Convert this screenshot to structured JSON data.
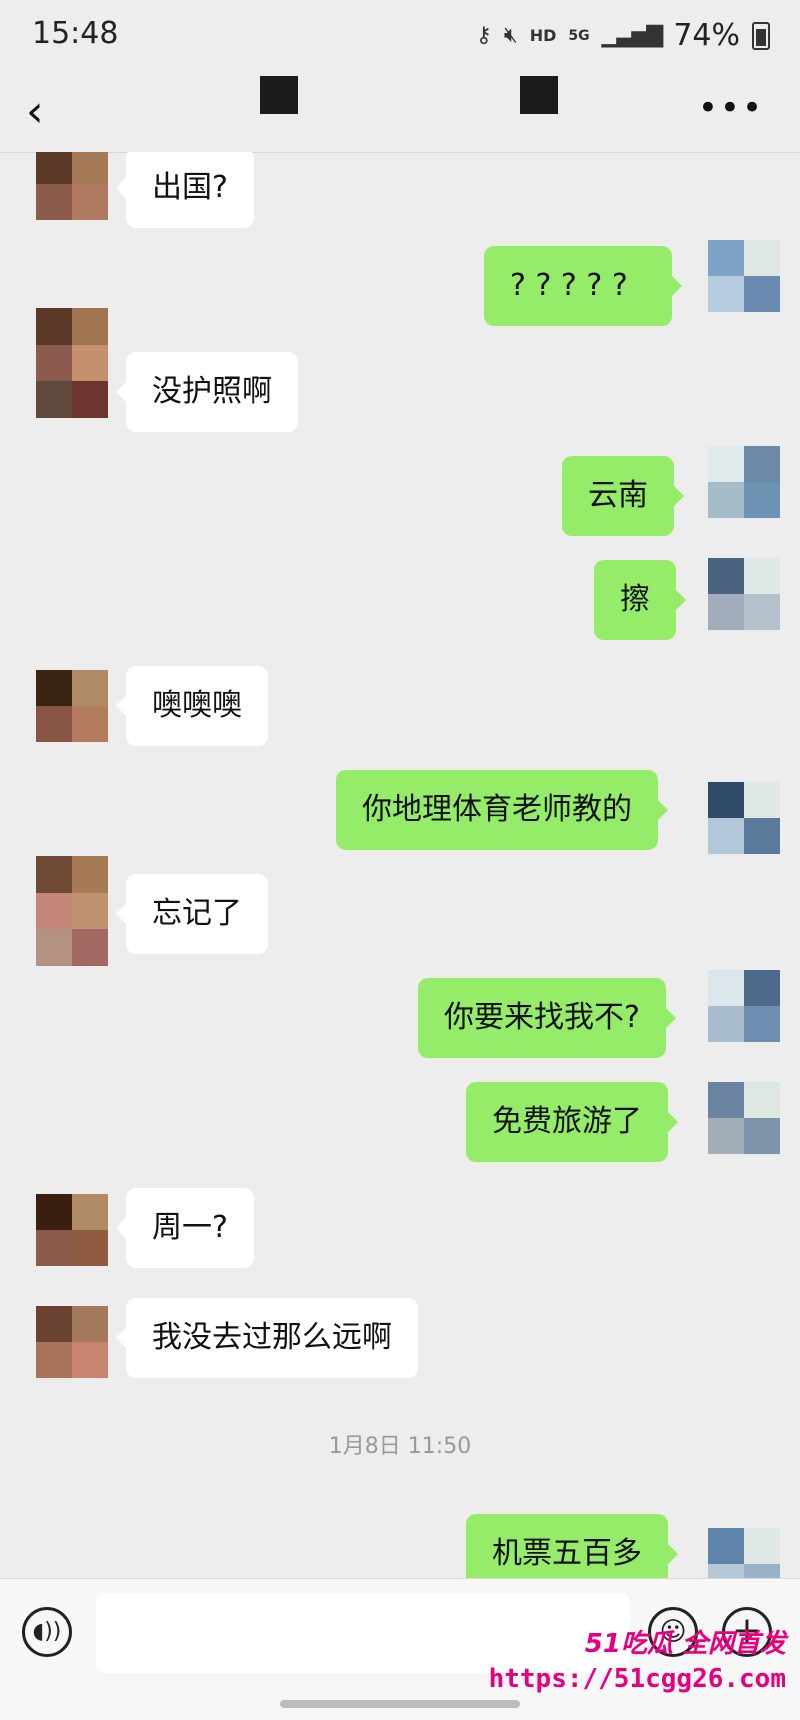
{
  "status_bar": {
    "time": "15:48",
    "network_hd": "HD",
    "network_5g": "5G",
    "battery_percent": "74%"
  },
  "nav": {
    "back_icon": "chevron-left-icon",
    "more_icon": "more-dots-icon"
  },
  "messages": [
    {
      "side": "in",
      "text": "出国?"
    },
    {
      "side": "out",
      "text": "? ? ? ? ?"
    },
    {
      "side": "in",
      "text": "没护照啊"
    },
    {
      "side": "out",
      "text": "云南"
    },
    {
      "side": "out",
      "text": "擦"
    },
    {
      "side": "in",
      "text": "噢噢噢"
    },
    {
      "side": "out",
      "text": "你地理体育老师教的"
    },
    {
      "side": "in",
      "text": "忘记了"
    },
    {
      "side": "out",
      "text": "你要来找我不?"
    },
    {
      "side": "out",
      "text": "免费旅游了"
    },
    {
      "side": "in",
      "text": "周一?"
    },
    {
      "side": "in",
      "text": "我没去过那么远啊"
    },
    {
      "side": "out",
      "text": "机票五百多"
    }
  ],
  "timestamp": "1月8日 11:50",
  "input_bar": {
    "voice_icon": "voice-icon",
    "emoji_icon": "emoji-icon",
    "plus_icon": "plus-icon"
  },
  "watermark": {
    "line1": "51吃瓜 全网首发",
    "line2": "https://51cgg26.com"
  },
  "colors": {
    "background": "#ededed",
    "out_bubble": "#95ec69",
    "in_bubble": "#ffffff",
    "watermark": "#e6007e"
  }
}
